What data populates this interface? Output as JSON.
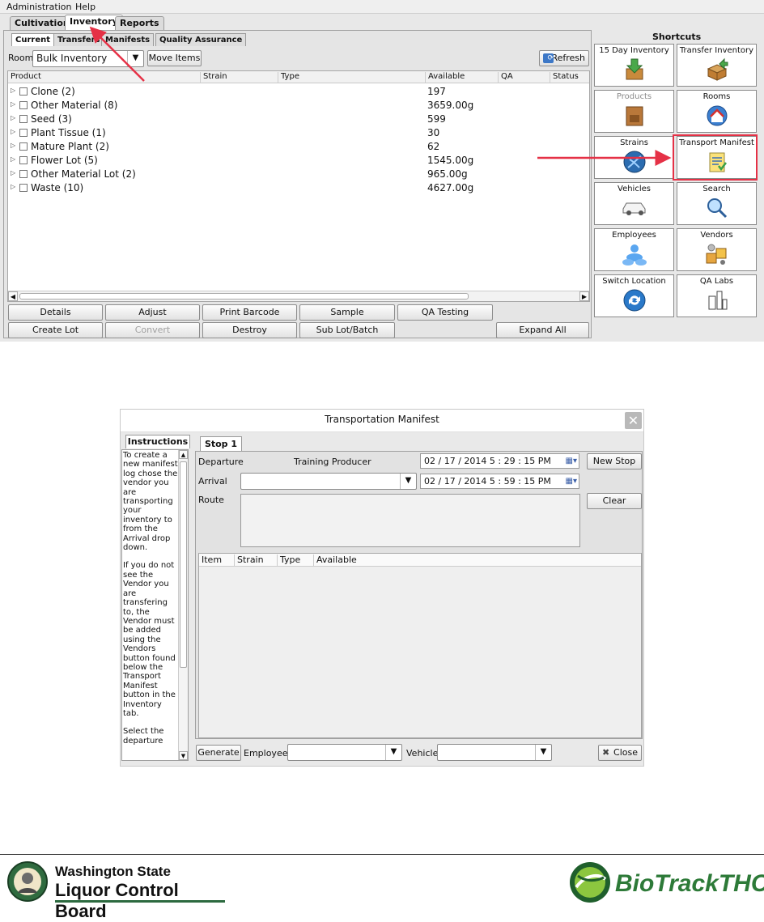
{
  "menubar": {
    "items": [
      "Administration",
      "Help"
    ]
  },
  "main_tabs": [
    "Cultivation",
    "Inventory",
    "Reports"
  ],
  "sub_tabs": [
    "Current",
    "Transfers",
    "Manifests",
    "Quality Assurance"
  ],
  "toolbar": {
    "room_label": "Room",
    "room_value": "Bulk Inventory",
    "move_items": "Move Items",
    "refresh": "Refresh"
  },
  "grid": {
    "columns": [
      "Product",
      "Strain",
      "Type",
      "Available",
      "QA",
      "Status"
    ],
    "rows": [
      {
        "name": "Clone (2)",
        "available": "197"
      },
      {
        "name": "Other Material (8)",
        "available": "3659.00g"
      },
      {
        "name": "Seed (3)",
        "available": "599"
      },
      {
        "name": "Plant Tissue (1)",
        "available": "30"
      },
      {
        "name": "Mature Plant (2)",
        "available": "62"
      },
      {
        "name": "Flower Lot (5)",
        "available": "1545.00g"
      },
      {
        "name": "Other Material Lot (2)",
        "available": "965.00g"
      },
      {
        "name": "Waste (10)",
        "available": "4627.00g"
      }
    ]
  },
  "actions": {
    "row1": [
      "Details",
      "Adjust",
      "Print Barcode",
      "Sample",
      "QA Testing"
    ],
    "row2": [
      "Create Lot",
      "Convert",
      "Destroy",
      "Sub Lot/Batch",
      "Expand All"
    ]
  },
  "shortcuts": {
    "title": "Shortcuts",
    "items": [
      "15 Day Inventory",
      "Transfer Inventory",
      "Products",
      "Rooms",
      "Strains",
      "Transport Manifest",
      "Vehicles",
      "Search",
      "Employees",
      "Vendors",
      "Switch Location",
      "QA Labs"
    ]
  },
  "dialog": {
    "title": "Transportation Manifest",
    "instructions_tab": "Instructions",
    "instructions_p1": "To create a new manifest log chose the vendor you are transporting your inventory to from the Arrival drop down.",
    "instructions_p2": "If you do not see the Vendor you are transfering to, the Vendor must be added using the Vendors button found below the Transport Manifest button in the Inventory tab.",
    "instructions_p3": "Select the departure",
    "stop_tab": "Stop 1",
    "departure_label": "Departure",
    "departure_value": "Training Producer",
    "arrival_label": "Arrival",
    "route_label": "Route",
    "departure_datetime": "02 / 17 / 2014    5 : 29 : 15   PM",
    "arrival_datetime": "02 / 17 / 2014    5 : 59 : 15   PM",
    "new_stop": "New Stop",
    "clear": "Clear",
    "item_columns": [
      "Item",
      "Strain",
      "Type",
      "Available"
    ],
    "generate": "Generate",
    "employee_label": "Employee",
    "vehicle_label": "Vehicle",
    "close": "Close"
  },
  "footer": {
    "wslcb_line1": "Washington State",
    "wslcb_line2": "Liquor Control Board",
    "biotrack": "BioTrackTHC"
  },
  "colors": {
    "annotation_red": "#e53146",
    "biotrack_green": "#2d7a38"
  }
}
